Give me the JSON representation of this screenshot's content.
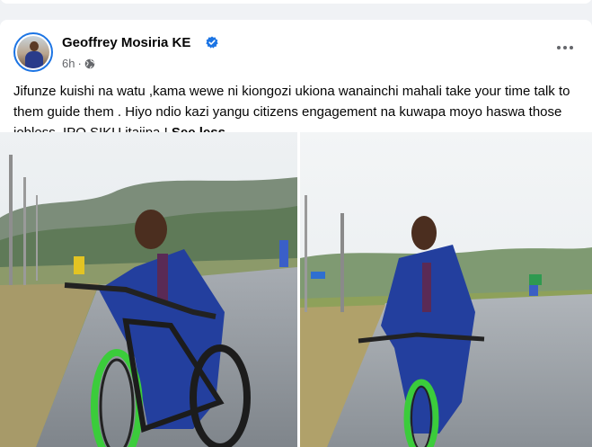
{
  "post": {
    "author": "Geoffrey Mosiria KE",
    "time": "6h",
    "separator": "·",
    "caption_text": "Jifunze kuishi na watu ,kama wewe ni kiongozi ukiona wanainchi mahali take your time talk to them guide them . Hiyo ndio kazi yangu citizens engagement na kuwapa moyo haswa those jobless.  IPO SIKU itajipa ! ",
    "see_less": "See less",
    "verified_icon": "verified-badge-icon",
    "privacy_icon": "globe-icon",
    "menu_icon": "more-horizontal-icon"
  },
  "colors": {
    "accent": "#1b74e4",
    "text_primary": "#050505",
    "text_secondary": "#65676b",
    "background": "#f0f2f5"
  }
}
